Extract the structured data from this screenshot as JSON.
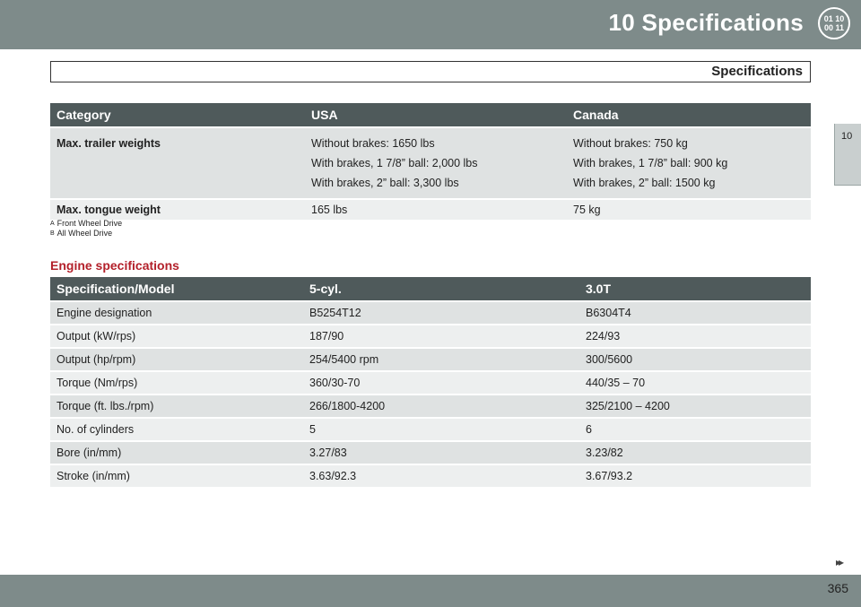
{
  "header": {
    "title": "10  Specifications",
    "icon_top": "01 10",
    "icon_bottom": "00 11"
  },
  "sidebar": {
    "chapter": "10"
  },
  "section_title": "Specifications",
  "trailer_table": {
    "headers": [
      "Category",
      "USA",
      "Canada"
    ],
    "rows": [
      {
        "category": "Max. trailer weights",
        "usa": [
          "Without brakes: 1650 lbs",
          "With brakes, 1 7/8” ball: 2,000 lbs",
          "With brakes, 2” ball: 3,300 lbs"
        ],
        "canada": [
          "Without brakes: 750 kg",
          "With brakes, 1 7/8” ball: 900 kg",
          "With brakes, 2” ball: 1500 kg"
        ]
      },
      {
        "category": "Max. tongue weight",
        "usa": [
          "165 lbs"
        ],
        "canada": [
          "75 kg"
        ]
      }
    ]
  },
  "footnotes": [
    {
      "mark": "A",
      "text": "Front Wheel Drive"
    },
    {
      "mark": "B",
      "text": "All Wheel Drive"
    }
  ],
  "engine_heading": "Engine specifications",
  "engine_table": {
    "headers": [
      "Specification/Model",
      "5-cyl.",
      "3.0T"
    ],
    "rows": [
      [
        "Engine designation",
        "B5254T12",
        "B6304T4"
      ],
      [
        "Output (kW/rps)",
        "187/90",
        "224/93"
      ],
      [
        "Output (hp/rpm)",
        "254/5400 rpm",
        "300/5600"
      ],
      [
        "Torque (Nm/rps)",
        "360/30-70",
        "440/35 – 70"
      ],
      [
        "Torque (ft. lbs./rpm)",
        "266/1800-4200",
        "325/2100 – 4200"
      ],
      [
        "No. of cylinders",
        "5",
        "6"
      ],
      [
        "Bore (in/mm)",
        "3.27/83",
        "3.23/82"
      ],
      [
        "Stroke (in/mm)",
        "3.63/92.3",
        "3.67/93.2"
      ]
    ]
  },
  "footer": {
    "next_arrows": "▸▸",
    "page_number": "365"
  }
}
